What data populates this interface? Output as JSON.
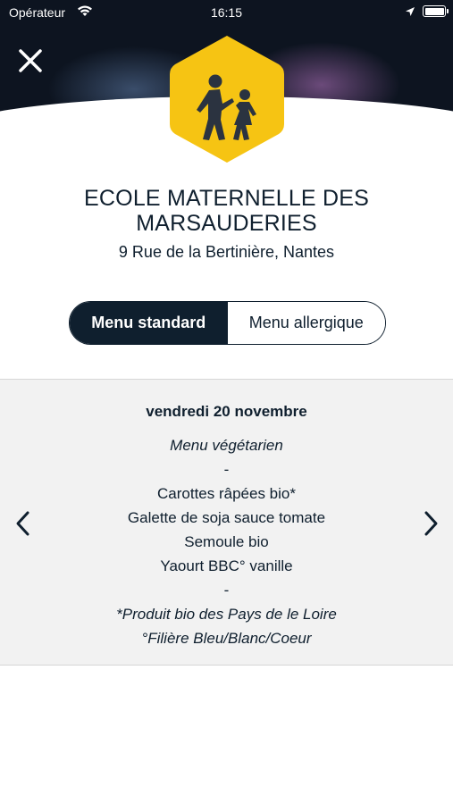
{
  "status_bar": {
    "carrier": "Opérateur",
    "time": "16:15"
  },
  "icons": {
    "close": "close-icon",
    "badge": "school-children-icon",
    "prev": "chevron-left-icon",
    "next": "chevron-right-icon"
  },
  "colors": {
    "accent": "#f6c413",
    "navy": "#0f1f2e",
    "panel": "#f2f2f2"
  },
  "school": {
    "name": "ECOLE MATERNELLE DES MARSAUDERIES",
    "address": "9 Rue de la Bertinière, Nantes"
  },
  "tabs": {
    "standard": "Menu standard",
    "allergic": "Menu allergique",
    "selected": "Menu standard"
  },
  "menu": {
    "date": "vendredi 20 novembre",
    "type": "Menu végétarien",
    "separator_1": "-",
    "items": [
      "Carottes râpées bio*",
      "Galette de soja sauce tomate",
      "Semoule bio",
      "Yaourt BBC° vanille"
    ],
    "separator_2": "-",
    "notes": [
      "*Produit bio des Pays de le Loire",
      "°Filière Bleu/Blanc/Coeur"
    ]
  }
}
